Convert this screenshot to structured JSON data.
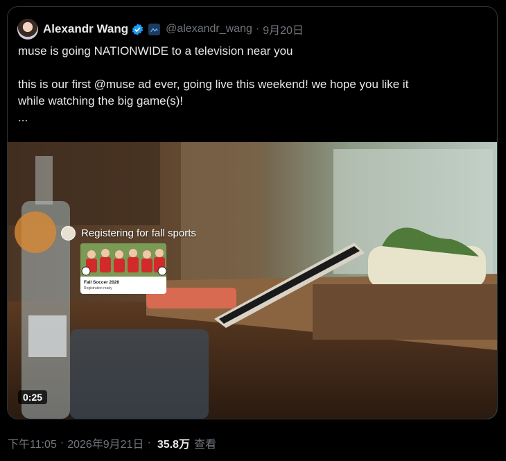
{
  "post": {
    "author_name": "Alexandr Wang",
    "handle": "@alexandr_wang",
    "separator": "·",
    "date": "9月20日",
    "text_line1": "muse is going NATIONWIDE to a television near you",
    "text_line2": "this is our first @muse ad ever, going live this weekend! we hope you like it",
    "text_line3": "while watching the big game(s)!",
    "text_more": "..."
  },
  "video": {
    "duration": "0:25",
    "overlay_title": "Registering for fall sports",
    "card_title": "Fall Soccer 2026",
    "card_subtitle": "Registration ready"
  },
  "footer": {
    "time": "下午11:05",
    "separator1": "·",
    "date": "2026年9月21日",
    "separator2": "·",
    "views": "35.8万",
    "views_label": "查看"
  },
  "colors": {
    "verified": "#1d9bf0",
    "secondary_text": "#71767b"
  },
  "icons": {
    "verified": "verified-badge-icon",
    "affiliate": "affiliate-badge-icon"
  }
}
